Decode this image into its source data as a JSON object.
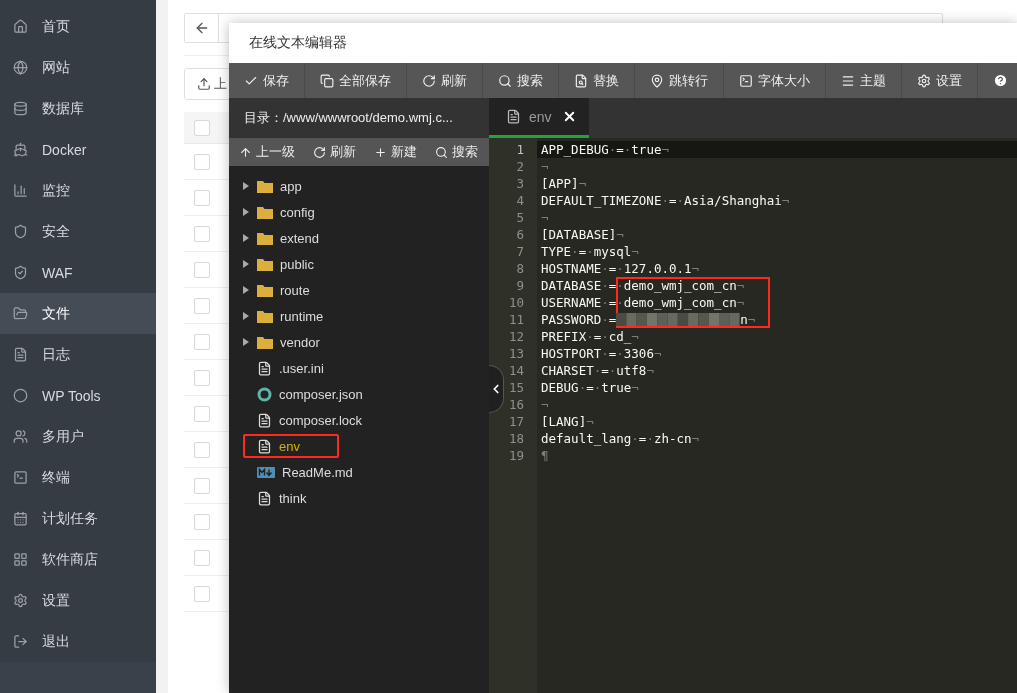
{
  "sidebar": {
    "items": [
      {
        "label": "首页",
        "selected": false
      },
      {
        "label": "网站",
        "selected": false
      },
      {
        "label": "数据库",
        "selected": false
      },
      {
        "label": "Docker",
        "selected": false
      },
      {
        "label": "监控",
        "selected": false
      },
      {
        "label": "安全",
        "selected": false
      },
      {
        "label": "WAF",
        "selected": false
      },
      {
        "label": "文件",
        "selected": true
      },
      {
        "label": "日志",
        "selected": false
      },
      {
        "label": "WP Tools",
        "selected": false
      },
      {
        "label": "多用户",
        "selected": false
      },
      {
        "label": "终端",
        "selected": false
      },
      {
        "label": "计划任务",
        "selected": false
      },
      {
        "label": "软件商店",
        "selected": false
      },
      {
        "label": "设置",
        "selected": false
      },
      {
        "label": "退出",
        "selected": false
      }
    ]
  },
  "files_page": {
    "upload_button": "上",
    "table": {
      "header": {
        "checked": false
      },
      "rows": [
        {
          "checked": false
        },
        {
          "checked": false
        },
        {
          "checked": false
        },
        {
          "checked": false
        },
        {
          "checked": false
        },
        {
          "checked": false
        },
        {
          "checked": false
        },
        {
          "checked": false
        },
        {
          "checked": false
        },
        {
          "checked": false
        },
        {
          "checked": false
        },
        {
          "checked": false
        },
        {
          "checked": false
        }
      ]
    }
  },
  "editor": {
    "title": "在线文本编辑器",
    "toolbar": [
      "保存",
      "全部保存",
      "刷新",
      "搜索",
      "替换",
      "跳转行",
      "字体大小",
      "主题",
      "设置"
    ],
    "directory": "目录：/www/wwwroot/demo.wmj.c...",
    "tree_toolbar": [
      "上一级",
      "刷新",
      "新建",
      "搜索"
    ],
    "tree": [
      {
        "kind": "folder",
        "name": "app",
        "active": false,
        "annotated": false
      },
      {
        "kind": "folder",
        "name": "config",
        "active": false,
        "annotated": false
      },
      {
        "kind": "folder",
        "name": "extend",
        "active": false,
        "annotated": false
      },
      {
        "kind": "folder",
        "name": "public",
        "active": false,
        "annotated": false
      },
      {
        "kind": "folder",
        "name": "route",
        "active": false,
        "annotated": false
      },
      {
        "kind": "folder",
        "name": "runtime",
        "active": false,
        "annotated": false
      },
      {
        "kind": "folder",
        "name": "vendor",
        "active": false,
        "annotated": false
      },
      {
        "kind": "file",
        "name": ".user.ini",
        "active": false,
        "annotated": false
      },
      {
        "kind": "json",
        "name": "composer.json",
        "active": false,
        "annotated": false
      },
      {
        "kind": "file",
        "name": "composer.lock",
        "active": false,
        "annotated": false
      },
      {
        "kind": "file",
        "name": "env",
        "active": true,
        "annotated": true
      },
      {
        "kind": "markdown",
        "name": "ReadMe.md",
        "active": false,
        "annotated": false
      },
      {
        "kind": "file",
        "name": "think",
        "active": false,
        "annotated": false
      }
    ],
    "tabs": [
      {
        "label": "env",
        "selected": true
      }
    ],
    "lines": [
      {
        "number": "1",
        "current": true,
        "annotated": false,
        "tokens": [
          {
            "kind": "text",
            "text": "APP_DEBUG"
          },
          {
            "kind": "mark",
            "text": "·"
          },
          {
            "kind": "text",
            "text": "="
          },
          {
            "kind": "mark",
            "text": "·"
          },
          {
            "kind": "text",
            "text": "true"
          },
          {
            "kind": "mark",
            "text": "¬"
          }
        ]
      },
      {
        "number": "2",
        "current": false,
        "annotated": false,
        "tokens": [
          {
            "kind": "mark",
            "text": "¬"
          }
        ]
      },
      {
        "number": "3",
        "current": false,
        "annotated": false,
        "tokens": [
          {
            "kind": "text",
            "text": "[APP]"
          },
          {
            "kind": "mark",
            "text": "¬"
          }
        ]
      },
      {
        "number": "4",
        "current": false,
        "annotated": false,
        "tokens": [
          {
            "kind": "text",
            "text": "DEFAULT_TIMEZONE"
          },
          {
            "kind": "mark",
            "text": "·"
          },
          {
            "kind": "text",
            "text": "="
          },
          {
            "kind": "mark",
            "text": "·"
          },
          {
            "kind": "text",
            "text": "Asia/Shanghai"
          },
          {
            "kind": "mark",
            "text": "¬"
          }
        ]
      },
      {
        "number": "5",
        "current": false,
        "annotated": false,
        "tokens": [
          {
            "kind": "mark",
            "text": "¬"
          }
        ]
      },
      {
        "number": "6",
        "current": false,
        "annotated": false,
        "tokens": [
          {
            "kind": "text",
            "text": "[DATABASE]"
          },
          {
            "kind": "mark",
            "text": "¬"
          }
        ]
      },
      {
        "number": "7",
        "current": false,
        "annotated": false,
        "tokens": [
          {
            "kind": "text",
            "text": "TYPE"
          },
          {
            "kind": "mark",
            "text": "·"
          },
          {
            "kind": "text",
            "text": "="
          },
          {
            "kind": "mark",
            "text": "·"
          },
          {
            "kind": "text",
            "text": "mysql"
          },
          {
            "kind": "mark",
            "text": "¬"
          }
        ]
      },
      {
        "number": "8",
        "current": false,
        "annotated": false,
        "tokens": [
          {
            "kind": "text",
            "text": "HOSTNAME"
          },
          {
            "kind": "mark",
            "text": "·"
          },
          {
            "kind": "text",
            "text": "="
          },
          {
            "kind": "mark",
            "text": "·"
          },
          {
            "kind": "text",
            "text": "127.0.0.1"
          },
          {
            "kind": "mark",
            "text": "¬"
          }
        ]
      },
      {
        "number": "9",
        "current": false,
        "annotated": true,
        "tokens": [
          {
            "kind": "text",
            "text": "DATABASE"
          },
          {
            "kind": "mark",
            "text": "·"
          },
          {
            "kind": "text",
            "text": "="
          },
          {
            "kind": "mark",
            "text": "·"
          },
          {
            "kind": "text",
            "text": "demo_wmj_com_cn"
          },
          {
            "kind": "mark",
            "text": "¬"
          }
        ]
      },
      {
        "number": "10",
        "current": false,
        "annotated": true,
        "tokens": [
          {
            "kind": "text",
            "text": "USERNAME"
          },
          {
            "kind": "mark",
            "text": "·"
          },
          {
            "kind": "text",
            "text": "="
          },
          {
            "kind": "mark",
            "text": "·"
          },
          {
            "kind": "text",
            "text": "demo_wmj_com_cn"
          },
          {
            "kind": "mark",
            "text": "¬"
          }
        ]
      },
      {
        "number": "11",
        "current": false,
        "annotated": true,
        "tokens": [
          {
            "kind": "text",
            "text": "PASSWORD"
          },
          {
            "kind": "mark",
            "text": "·"
          },
          {
            "kind": "text",
            "text": "="
          },
          {
            "kind": "redacted"
          },
          {
            "kind": "text",
            "text": "n"
          },
          {
            "kind": "mark",
            "text": "¬"
          }
        ]
      },
      {
        "number": "12",
        "current": false,
        "annotated": false,
        "tokens": [
          {
            "kind": "text",
            "text": "PREFIX"
          },
          {
            "kind": "mark",
            "text": "·"
          },
          {
            "kind": "text",
            "text": "="
          },
          {
            "kind": "mark",
            "text": "·"
          },
          {
            "kind": "text",
            "text": "cd_"
          },
          {
            "kind": "mark",
            "text": "¬"
          }
        ]
      },
      {
        "number": "13",
        "current": false,
        "annotated": false,
        "tokens": [
          {
            "kind": "text",
            "text": "HOSTPORT"
          },
          {
            "kind": "mark",
            "text": "·"
          },
          {
            "kind": "text",
            "text": "="
          },
          {
            "kind": "mark",
            "text": "·"
          },
          {
            "kind": "text",
            "text": "3306"
          },
          {
            "kind": "mark",
            "text": "¬"
          }
        ]
      },
      {
        "number": "14",
        "current": false,
        "annotated": false,
        "tokens": [
          {
            "kind": "text",
            "text": "CHARSET"
          },
          {
            "kind": "mark",
            "text": "·"
          },
          {
            "kind": "text",
            "text": "="
          },
          {
            "kind": "mark",
            "text": "·"
          },
          {
            "kind": "text",
            "text": "utf8"
          },
          {
            "kind": "mark",
            "text": "¬"
          }
        ]
      },
      {
        "number": "15",
        "current": false,
        "annotated": false,
        "tokens": [
          {
            "kind": "text",
            "text": "DEBUG"
          },
          {
            "kind": "mark",
            "text": "·"
          },
          {
            "kind": "text",
            "text": "="
          },
          {
            "kind": "mark",
            "text": "·"
          },
          {
            "kind": "text",
            "text": "true"
          },
          {
            "kind": "mark",
            "text": "¬"
          }
        ]
      },
      {
        "number": "16",
        "current": false,
        "annotated": false,
        "tokens": [
          {
            "kind": "mark",
            "text": "¬"
          }
        ]
      },
      {
        "number": "17",
        "current": false,
        "annotated": false,
        "tokens": [
          {
            "kind": "text",
            "text": "[LANG]"
          },
          {
            "kind": "mark",
            "text": "¬"
          }
        ]
      },
      {
        "number": "18",
        "current": false,
        "annotated": false,
        "tokens": [
          {
            "kind": "text",
            "text": "default_lang"
          },
          {
            "kind": "mark",
            "text": "·"
          },
          {
            "kind": "text",
            "text": "="
          },
          {
            "kind": "mark",
            "text": "·"
          },
          {
            "kind": "text",
            "text": "zh-cn"
          },
          {
            "kind": "mark",
            "text": "¬"
          }
        ]
      },
      {
        "number": "19",
        "current": false,
        "annotated": false,
        "tokens": [
          {
            "kind": "mark",
            "text": "¶"
          }
        ]
      }
    ]
  }
}
